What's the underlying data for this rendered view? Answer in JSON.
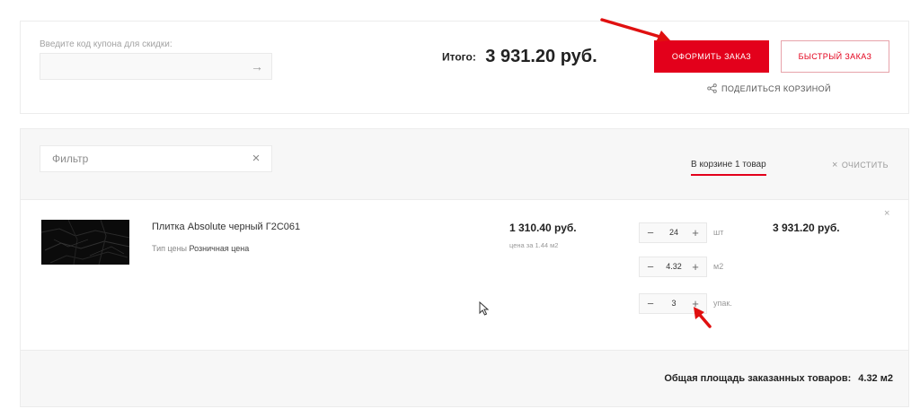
{
  "coupon": {
    "label": "Введите код купона для скидки:",
    "value": "",
    "submit_icon": "arrow-right-icon",
    "submit_glyph": "→"
  },
  "summary": {
    "total_label": "Итого:",
    "total_value": "3 931.20 руб.",
    "order_button": "Оформить заказ",
    "quick_order_button": "Быстрый заказ",
    "share_label": "Поделиться корзиной"
  },
  "filter": {
    "placeholder": "Фильтр",
    "clear_glyph": "×"
  },
  "cart": {
    "count_label": "В корзине 1 товар",
    "clear_label": "очистить",
    "clear_glyph": "×"
  },
  "item": {
    "name": "Плитка Absolute черный Г2С061",
    "price_type_label": "Тип цены",
    "price_type_value": "Розничная цена",
    "unit_price": "1 310.40 руб.",
    "unit_price_note": "цена за 1.44 м2",
    "line_total": "3 931.20 руб.",
    "remove_glyph": "×",
    "quantities": [
      {
        "value": "24",
        "unit": "шт"
      },
      {
        "value": "4.32",
        "unit": "м2"
      },
      {
        "value": "3",
        "unit": "упак."
      }
    ],
    "minus_glyph": "−",
    "plus_glyph": "+"
  },
  "footer": {
    "area_label": "Общая площадь заказанных товаров:",
    "area_value": "4.32 м2"
  },
  "colors": {
    "accent": "#e3001b",
    "annotation": "#e01010"
  }
}
